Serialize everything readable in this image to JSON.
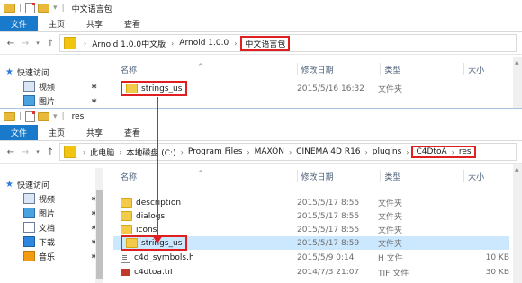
{
  "window_top": {
    "title": "中文语言包",
    "ribbon": [
      "文件",
      "主页",
      "共享",
      "查看"
    ],
    "breadcrumbs": [
      "Arnold 1.0.0中文版",
      "Arnold 1.0.0",
      "中文语言包"
    ],
    "nav": [
      {
        "label": "快速访问",
        "icon": "star-icon"
      },
      {
        "label": "视频",
        "icon": "video-icon"
      },
      {
        "label": "图片",
        "icon": "picture-icon"
      }
    ],
    "columns": {
      "name": "名称",
      "date": "修改日期",
      "type": "类型",
      "size": "大小"
    },
    "rows": [
      {
        "name": "strings_us",
        "date": "2015/5/16 16:32",
        "type": "文件夹",
        "size": ""
      }
    ]
  },
  "window_bottom": {
    "title": "res",
    "ribbon": [
      "文件",
      "主页",
      "共享",
      "查看"
    ],
    "breadcrumbs": [
      "此电脑",
      "本地磁盘 (C:)",
      "Program Files",
      "MAXON",
      "CINEMA 4D R16",
      "plugins",
      "C4DtoA",
      "res"
    ],
    "nav": [
      {
        "label": "快速访问",
        "icon": "star-icon"
      },
      {
        "label": "视频",
        "icon": "video-icon"
      },
      {
        "label": "图片",
        "icon": "picture-icon"
      },
      {
        "label": "文档",
        "icon": "document-icon"
      },
      {
        "label": "下载",
        "icon": "download-icon"
      },
      {
        "label": "音乐",
        "icon": "music-icon"
      }
    ],
    "columns": {
      "name": "名称",
      "date": "修改日期",
      "type": "类型",
      "size": "大小"
    },
    "rows": [
      {
        "name": "description",
        "date": "2015/5/17 8:55",
        "type": "文件夹",
        "size": ""
      },
      {
        "name": "dialogs",
        "date": "2015/5/17 8:55",
        "type": "文件夹",
        "size": ""
      },
      {
        "name": "icons",
        "date": "2015/5/17 8:55",
        "type": "文件夹",
        "size": ""
      },
      {
        "name": "strings_us",
        "date": "2015/5/17 8:59",
        "type": "文件夹",
        "size": ""
      },
      {
        "name": "c4d_symbols.h",
        "date": "2015/5/9 0:14",
        "type": "H 文件",
        "size": "10 KB"
      },
      {
        "name": "c4dtoa.tif",
        "date": "2014/7/3 21:07",
        "type": "TIF 文件",
        "size": "30 KB"
      }
    ]
  },
  "colors": {
    "accent": "#1979ca",
    "highlight": "#e02020",
    "selection": "#cce8ff",
    "folder": "#f4ca4a"
  }
}
